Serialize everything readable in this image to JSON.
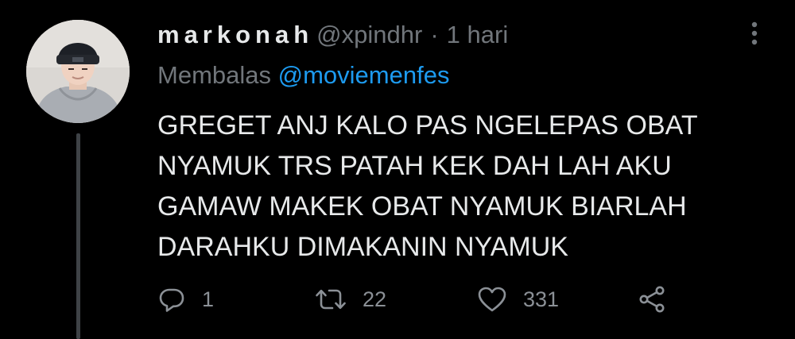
{
  "tweet": {
    "display_name": "markonah",
    "handle": "@xpindhr",
    "separator": "·",
    "time": "1 hari",
    "reply_prefix": "Membalas",
    "reply_to": "@moviemenfes",
    "text_lines": [
      "GREGET ANJ KALO PAS NGELEPAS OBAT",
      "NYAMUK TRS PATAH KEK DAH LAH AKU",
      "GAMAW MAKEK OBAT NYAMUK BIARLAH",
      "DARAHKU DIMAKANIN NYAMUK"
    ]
  },
  "actions": {
    "reply_count": "1",
    "retweet_count": "22",
    "like_count": "331"
  },
  "icons": {
    "more": "more-vertical-icon",
    "reply": "reply-icon",
    "retweet": "retweet-icon",
    "like": "heart-icon",
    "share": "share-icon"
  },
  "colors": {
    "background": "#000000",
    "text": "#e7e9ea",
    "muted": "#71767b",
    "mention": "#1d9bf0",
    "thread_line": "#3e4246"
  }
}
